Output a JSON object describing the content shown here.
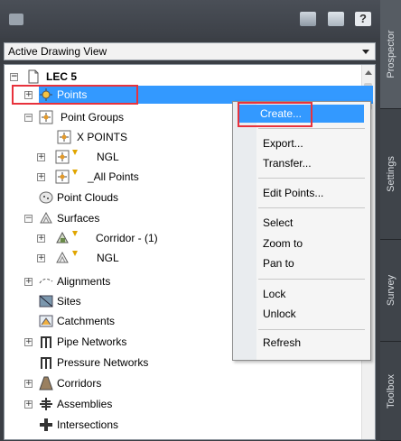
{
  "toolbar": {
    "help_label": "?"
  },
  "view_selector": {
    "value": "Active Drawing View"
  },
  "tree": {
    "root": {
      "label": "LEC 5"
    },
    "points": {
      "label": "Points"
    },
    "point_groups": {
      "label": "Point Groups",
      "children": [
        "X POINTS",
        "NGL",
        "_All Points"
      ]
    },
    "point_clouds": {
      "label": "Point Clouds"
    },
    "surfaces": {
      "label": "Surfaces",
      "children": [
        "Corridor - (1)",
        "NGL"
      ]
    },
    "items": [
      "Alignments",
      "Sites",
      "Catchments",
      "Pipe Networks",
      "Pressure Networks",
      "Corridors",
      "Assemblies",
      "Intersections"
    ]
  },
  "context_menu": {
    "items": [
      "Create...",
      "Export...",
      "Transfer...",
      "Edit Points...",
      "Select",
      "Zoom to",
      "Pan to",
      "Lock",
      "Unlock",
      "Refresh"
    ]
  },
  "side_tabs": [
    "Prospector",
    "Settings",
    "Survey",
    "Toolbox"
  ],
  "colors": {
    "selection": "#3399ff",
    "highlight_box": "#e8323c",
    "panel_bg": "#3b3f45"
  }
}
